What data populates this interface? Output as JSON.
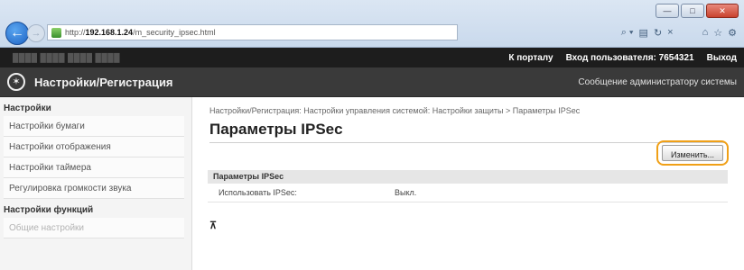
{
  "browser": {
    "url_prefix": "http://",
    "url_host": "192.168.1.24",
    "url_path": "/m_security_ipsec.html",
    "search_icon": "⌕ ▾",
    "stop_refresh": "×",
    "win_min": "—",
    "win_max": "□",
    "win_close": "✕"
  },
  "device_bar": {
    "device_name": "████ ████ ████ ████",
    "portal_link": "К порталу",
    "login_info": "Вход пользователя: 7654321",
    "logout_link": "Выход"
  },
  "title_bar": {
    "app_title": "Настройки/Регистрация",
    "admin_msg": "Сообщение администратору системы"
  },
  "sidebar": {
    "header1": "Настройки",
    "items": [
      {
        "label": "Настройки бумаги"
      },
      {
        "label": "Настройки отображения"
      },
      {
        "label": "Настройки таймера"
      },
      {
        "label": "Регулировка громкости звука"
      }
    ],
    "header2": "Настройки функций",
    "disabled_item": "Общие настройки"
  },
  "main": {
    "breadcrumb": "Настройки/Регистрация: Настройки управления системой: Настройки защиты > Параметры IPSec",
    "title": "Параметры IPSec",
    "edit_label": "Изменить...",
    "section_title": "Параметры IPSec",
    "row_label": "Использовать IPSec:",
    "row_value": "Выкл.",
    "top_glyph": "⊼"
  },
  "colors": {
    "highlight": "#f0a017",
    "title_bar": "#3a3a3a",
    "device_bar": "#1d1d1d"
  }
}
